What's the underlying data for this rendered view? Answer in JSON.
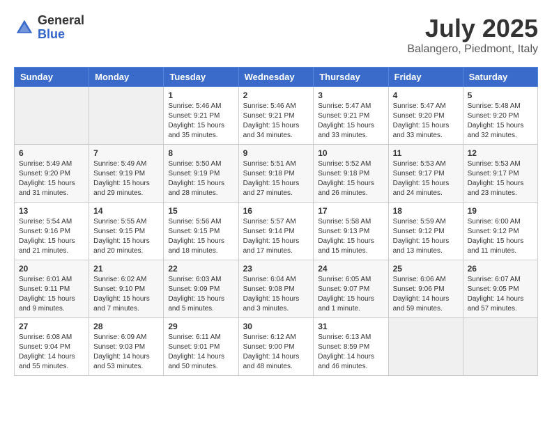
{
  "header": {
    "logo_general": "General",
    "logo_blue": "Blue",
    "month_year": "July 2025",
    "location": "Balangero, Piedmont, Italy"
  },
  "weekdays": [
    "Sunday",
    "Monday",
    "Tuesday",
    "Wednesday",
    "Thursday",
    "Friday",
    "Saturday"
  ],
  "weeks": [
    [
      {
        "day": "",
        "info": ""
      },
      {
        "day": "",
        "info": ""
      },
      {
        "day": "1",
        "info": "Sunrise: 5:46 AM\nSunset: 9:21 PM\nDaylight: 15 hours and 35 minutes."
      },
      {
        "day": "2",
        "info": "Sunrise: 5:46 AM\nSunset: 9:21 PM\nDaylight: 15 hours and 34 minutes."
      },
      {
        "day": "3",
        "info": "Sunrise: 5:47 AM\nSunset: 9:21 PM\nDaylight: 15 hours and 33 minutes."
      },
      {
        "day": "4",
        "info": "Sunrise: 5:47 AM\nSunset: 9:20 PM\nDaylight: 15 hours and 33 minutes."
      },
      {
        "day": "5",
        "info": "Sunrise: 5:48 AM\nSunset: 9:20 PM\nDaylight: 15 hours and 32 minutes."
      }
    ],
    [
      {
        "day": "6",
        "info": "Sunrise: 5:49 AM\nSunset: 9:20 PM\nDaylight: 15 hours and 31 minutes."
      },
      {
        "day": "7",
        "info": "Sunrise: 5:49 AM\nSunset: 9:19 PM\nDaylight: 15 hours and 29 minutes."
      },
      {
        "day": "8",
        "info": "Sunrise: 5:50 AM\nSunset: 9:19 PM\nDaylight: 15 hours and 28 minutes."
      },
      {
        "day": "9",
        "info": "Sunrise: 5:51 AM\nSunset: 9:18 PM\nDaylight: 15 hours and 27 minutes."
      },
      {
        "day": "10",
        "info": "Sunrise: 5:52 AM\nSunset: 9:18 PM\nDaylight: 15 hours and 26 minutes."
      },
      {
        "day": "11",
        "info": "Sunrise: 5:53 AM\nSunset: 9:17 PM\nDaylight: 15 hours and 24 minutes."
      },
      {
        "day": "12",
        "info": "Sunrise: 5:53 AM\nSunset: 9:17 PM\nDaylight: 15 hours and 23 minutes."
      }
    ],
    [
      {
        "day": "13",
        "info": "Sunrise: 5:54 AM\nSunset: 9:16 PM\nDaylight: 15 hours and 21 minutes."
      },
      {
        "day": "14",
        "info": "Sunrise: 5:55 AM\nSunset: 9:15 PM\nDaylight: 15 hours and 20 minutes."
      },
      {
        "day": "15",
        "info": "Sunrise: 5:56 AM\nSunset: 9:15 PM\nDaylight: 15 hours and 18 minutes."
      },
      {
        "day": "16",
        "info": "Sunrise: 5:57 AM\nSunset: 9:14 PM\nDaylight: 15 hours and 17 minutes."
      },
      {
        "day": "17",
        "info": "Sunrise: 5:58 AM\nSunset: 9:13 PM\nDaylight: 15 hours and 15 minutes."
      },
      {
        "day": "18",
        "info": "Sunrise: 5:59 AM\nSunset: 9:12 PM\nDaylight: 15 hours and 13 minutes."
      },
      {
        "day": "19",
        "info": "Sunrise: 6:00 AM\nSunset: 9:12 PM\nDaylight: 15 hours and 11 minutes."
      }
    ],
    [
      {
        "day": "20",
        "info": "Sunrise: 6:01 AM\nSunset: 9:11 PM\nDaylight: 15 hours and 9 minutes."
      },
      {
        "day": "21",
        "info": "Sunrise: 6:02 AM\nSunset: 9:10 PM\nDaylight: 15 hours and 7 minutes."
      },
      {
        "day": "22",
        "info": "Sunrise: 6:03 AM\nSunset: 9:09 PM\nDaylight: 15 hours and 5 minutes."
      },
      {
        "day": "23",
        "info": "Sunrise: 6:04 AM\nSunset: 9:08 PM\nDaylight: 15 hours and 3 minutes."
      },
      {
        "day": "24",
        "info": "Sunrise: 6:05 AM\nSunset: 9:07 PM\nDaylight: 15 hours and 1 minute."
      },
      {
        "day": "25",
        "info": "Sunrise: 6:06 AM\nSunset: 9:06 PM\nDaylight: 14 hours and 59 minutes."
      },
      {
        "day": "26",
        "info": "Sunrise: 6:07 AM\nSunset: 9:05 PM\nDaylight: 14 hours and 57 minutes."
      }
    ],
    [
      {
        "day": "27",
        "info": "Sunrise: 6:08 AM\nSunset: 9:04 PM\nDaylight: 14 hours and 55 minutes."
      },
      {
        "day": "28",
        "info": "Sunrise: 6:09 AM\nSunset: 9:03 PM\nDaylight: 14 hours and 53 minutes."
      },
      {
        "day": "29",
        "info": "Sunrise: 6:11 AM\nSunset: 9:01 PM\nDaylight: 14 hours and 50 minutes."
      },
      {
        "day": "30",
        "info": "Sunrise: 6:12 AM\nSunset: 9:00 PM\nDaylight: 14 hours and 48 minutes."
      },
      {
        "day": "31",
        "info": "Sunrise: 6:13 AM\nSunset: 8:59 PM\nDaylight: 14 hours and 46 minutes."
      },
      {
        "day": "",
        "info": ""
      },
      {
        "day": "",
        "info": ""
      }
    ]
  ]
}
